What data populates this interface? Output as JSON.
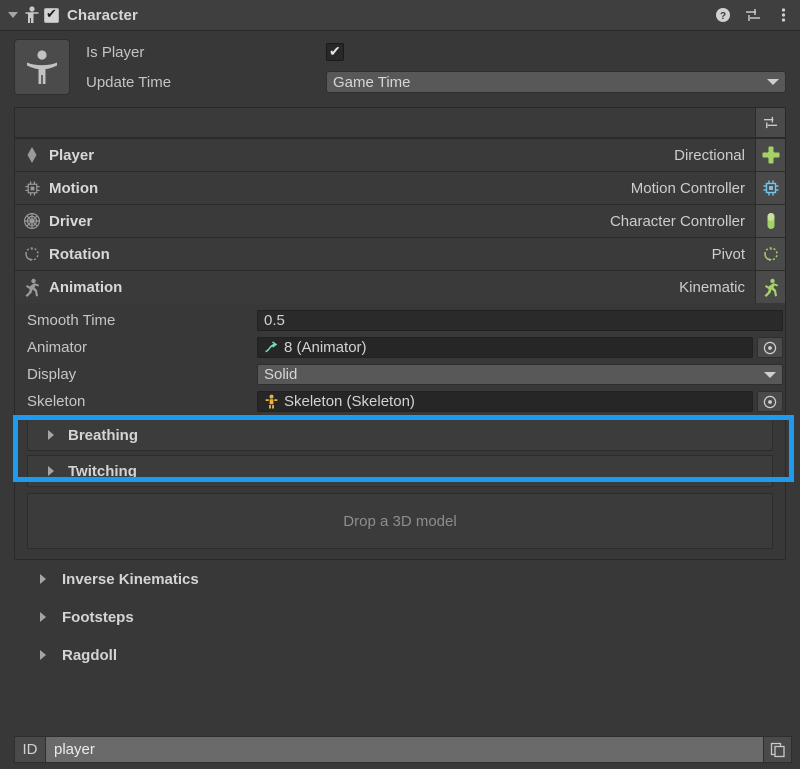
{
  "header": {
    "title": "Character",
    "enabled_checkbox": true,
    "component_icon": "person-icon",
    "foldout_icon": "chevron-down-icon",
    "actions": [
      {
        "name": "help-icon",
        "label": "?"
      },
      {
        "name": "preset-icon",
        "label": ""
      },
      {
        "name": "more-menu-icon",
        "label": ""
      }
    ]
  },
  "top": {
    "thumbnail_icon": "person-accessibility-icon",
    "is_player_label": "Is Player",
    "is_player_value": true,
    "update_time_label": "Update Time",
    "update_time_value": "Game Time"
  },
  "component_list": {
    "toolbar_icon": "settings-sliders-icon",
    "rows": [
      {
        "name": "Player",
        "value": "Directional",
        "left_icon": "diamond-icon",
        "right_icon": "dpad-icon",
        "color": "#a5d166"
      },
      {
        "name": "Motion",
        "value": "Motion Controller",
        "left_icon": "chip-icon",
        "right_icon": "chip-icon",
        "color": "#76c5e8"
      },
      {
        "name": "Driver",
        "value": "Character Controller",
        "left_icon": "wheel-icon",
        "right_icon": "capsule-icon",
        "color": "#a5d166"
      },
      {
        "name": "Rotation",
        "value": "Pivot",
        "left_icon": "rotation-icon",
        "right_icon": "rotation-icon",
        "color": "#a5d166"
      },
      {
        "name": "Animation",
        "value": "Kinematic",
        "left_icon": "running-icon",
        "right_icon": "running-icon",
        "color": "#a5d166"
      }
    ]
  },
  "properties": [
    {
      "label": "Smooth Time",
      "value": "0.5",
      "kind": "text",
      "icon": "",
      "icon_color": ""
    },
    {
      "label": "Animator",
      "value": "8 (Animator)",
      "kind": "object",
      "icon": "animator-icon",
      "icon_color": "#7fd9c4"
    },
    {
      "label": "Display",
      "value": "Solid",
      "kind": "dropdown",
      "icon": "",
      "icon_color": ""
    },
    {
      "label": "Skeleton",
      "value": "Skeleton (Skeleton)",
      "kind": "object",
      "icon": "prefab-humanoid-icon",
      "icon_color": "#e8b33c"
    }
  ],
  "sub_foldouts": [
    {
      "label": "Breathing"
    },
    {
      "label": "Twitching"
    }
  ],
  "dropzone": {
    "text": "Drop a 3D model"
  },
  "outer_foldouts": [
    {
      "label": "Inverse Kinematics"
    },
    {
      "label": "Footsteps"
    },
    {
      "label": "Ragdoll"
    }
  ],
  "id_bar": {
    "tag": "ID",
    "value": "player",
    "copy_icon": "copy-icon"
  },
  "highlight": {
    "color": "#1d9bf0",
    "target": "Skeleton"
  }
}
